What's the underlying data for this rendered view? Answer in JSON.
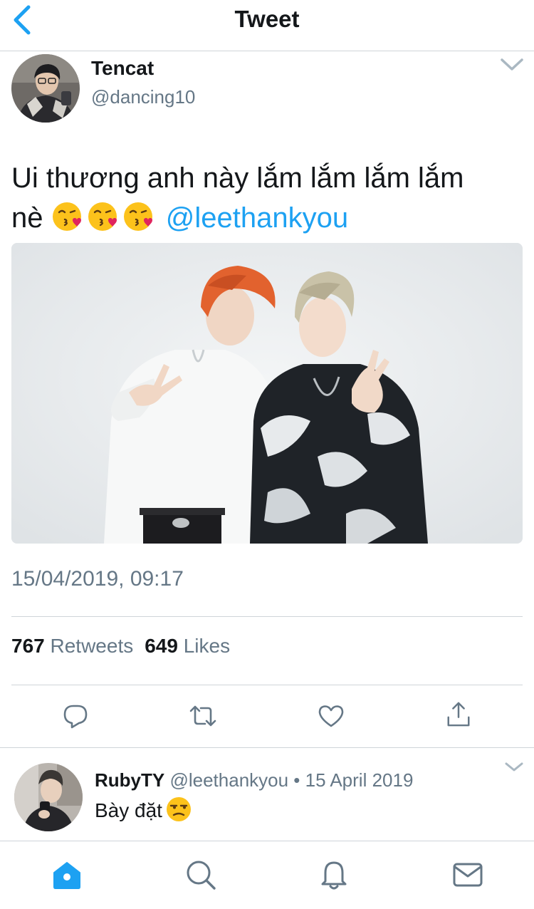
{
  "header": {
    "title": "Tweet",
    "back_icon": "chevron-left-icon"
  },
  "tweet": {
    "author": {
      "name": "Tencat",
      "handle": "@dancing10"
    },
    "text_line1": "Ui thương anh này lắm lắm lắm lắm",
    "text_prefix": "nè",
    "emojis": [
      "kissing-face-with-heart-emoji",
      "kissing-face-with-heart-emoji",
      "kissing-face-with-heart-emoji"
    ],
    "mention": "@leethankyou",
    "timestamp": "15/04/2019, 09:17",
    "stats": {
      "retweets_count": "767",
      "retweets_label": "Retweets",
      "likes_count": "649",
      "likes_label": "Likes"
    },
    "actions": [
      "reply-icon",
      "retweet-icon",
      "heart-icon",
      "share-icon"
    ]
  },
  "reply": {
    "name": "RubyTY",
    "meta": "@leethankyou • 15 April 2019",
    "text": "Bày đặt",
    "emoji": "unamused-face-emoji"
  },
  "tabbar": {
    "tabs": [
      "home-icon",
      "search-icon",
      "notifications-icon",
      "messages-icon"
    ],
    "active": "home-icon"
  },
  "colors": {
    "accent": "#1da1f2",
    "text_primary": "#14171a",
    "text_secondary": "#657786",
    "divider": "#cfd4d9"
  }
}
